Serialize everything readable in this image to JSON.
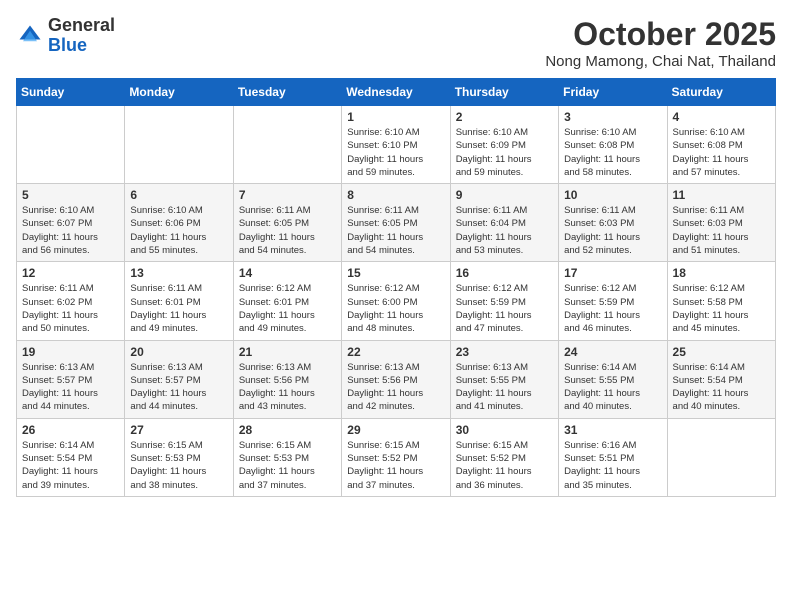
{
  "header": {
    "logo_general": "General",
    "logo_blue": "Blue",
    "month": "October 2025",
    "location": "Nong Mamong, Chai Nat, Thailand"
  },
  "weekdays": [
    "Sunday",
    "Monday",
    "Tuesday",
    "Wednesday",
    "Thursday",
    "Friday",
    "Saturday"
  ],
  "weeks": [
    [
      {
        "day": "",
        "info": ""
      },
      {
        "day": "",
        "info": ""
      },
      {
        "day": "",
        "info": ""
      },
      {
        "day": "1",
        "info": "Sunrise: 6:10 AM\nSunset: 6:10 PM\nDaylight: 11 hours\nand 59 minutes."
      },
      {
        "day": "2",
        "info": "Sunrise: 6:10 AM\nSunset: 6:09 PM\nDaylight: 11 hours\nand 59 minutes."
      },
      {
        "day": "3",
        "info": "Sunrise: 6:10 AM\nSunset: 6:08 PM\nDaylight: 11 hours\nand 58 minutes."
      },
      {
        "day": "4",
        "info": "Sunrise: 6:10 AM\nSunset: 6:08 PM\nDaylight: 11 hours\nand 57 minutes."
      }
    ],
    [
      {
        "day": "5",
        "info": "Sunrise: 6:10 AM\nSunset: 6:07 PM\nDaylight: 11 hours\nand 56 minutes."
      },
      {
        "day": "6",
        "info": "Sunrise: 6:10 AM\nSunset: 6:06 PM\nDaylight: 11 hours\nand 55 minutes."
      },
      {
        "day": "7",
        "info": "Sunrise: 6:11 AM\nSunset: 6:05 PM\nDaylight: 11 hours\nand 54 minutes."
      },
      {
        "day": "8",
        "info": "Sunrise: 6:11 AM\nSunset: 6:05 PM\nDaylight: 11 hours\nand 54 minutes."
      },
      {
        "day": "9",
        "info": "Sunrise: 6:11 AM\nSunset: 6:04 PM\nDaylight: 11 hours\nand 53 minutes."
      },
      {
        "day": "10",
        "info": "Sunrise: 6:11 AM\nSunset: 6:03 PM\nDaylight: 11 hours\nand 52 minutes."
      },
      {
        "day": "11",
        "info": "Sunrise: 6:11 AM\nSunset: 6:03 PM\nDaylight: 11 hours\nand 51 minutes."
      }
    ],
    [
      {
        "day": "12",
        "info": "Sunrise: 6:11 AM\nSunset: 6:02 PM\nDaylight: 11 hours\nand 50 minutes."
      },
      {
        "day": "13",
        "info": "Sunrise: 6:11 AM\nSunset: 6:01 PM\nDaylight: 11 hours\nand 49 minutes."
      },
      {
        "day": "14",
        "info": "Sunrise: 6:12 AM\nSunset: 6:01 PM\nDaylight: 11 hours\nand 49 minutes."
      },
      {
        "day": "15",
        "info": "Sunrise: 6:12 AM\nSunset: 6:00 PM\nDaylight: 11 hours\nand 48 minutes."
      },
      {
        "day": "16",
        "info": "Sunrise: 6:12 AM\nSunset: 5:59 PM\nDaylight: 11 hours\nand 47 minutes."
      },
      {
        "day": "17",
        "info": "Sunrise: 6:12 AM\nSunset: 5:59 PM\nDaylight: 11 hours\nand 46 minutes."
      },
      {
        "day": "18",
        "info": "Sunrise: 6:12 AM\nSunset: 5:58 PM\nDaylight: 11 hours\nand 45 minutes."
      }
    ],
    [
      {
        "day": "19",
        "info": "Sunrise: 6:13 AM\nSunset: 5:57 PM\nDaylight: 11 hours\nand 44 minutes."
      },
      {
        "day": "20",
        "info": "Sunrise: 6:13 AM\nSunset: 5:57 PM\nDaylight: 11 hours\nand 44 minutes."
      },
      {
        "day": "21",
        "info": "Sunrise: 6:13 AM\nSunset: 5:56 PM\nDaylight: 11 hours\nand 43 minutes."
      },
      {
        "day": "22",
        "info": "Sunrise: 6:13 AM\nSunset: 5:56 PM\nDaylight: 11 hours\nand 42 minutes."
      },
      {
        "day": "23",
        "info": "Sunrise: 6:13 AM\nSunset: 5:55 PM\nDaylight: 11 hours\nand 41 minutes."
      },
      {
        "day": "24",
        "info": "Sunrise: 6:14 AM\nSunset: 5:55 PM\nDaylight: 11 hours\nand 40 minutes."
      },
      {
        "day": "25",
        "info": "Sunrise: 6:14 AM\nSunset: 5:54 PM\nDaylight: 11 hours\nand 40 minutes."
      }
    ],
    [
      {
        "day": "26",
        "info": "Sunrise: 6:14 AM\nSunset: 5:54 PM\nDaylight: 11 hours\nand 39 minutes."
      },
      {
        "day": "27",
        "info": "Sunrise: 6:15 AM\nSunset: 5:53 PM\nDaylight: 11 hours\nand 38 minutes."
      },
      {
        "day": "28",
        "info": "Sunrise: 6:15 AM\nSunset: 5:53 PM\nDaylight: 11 hours\nand 37 minutes."
      },
      {
        "day": "29",
        "info": "Sunrise: 6:15 AM\nSunset: 5:52 PM\nDaylight: 11 hours\nand 37 minutes."
      },
      {
        "day": "30",
        "info": "Sunrise: 6:15 AM\nSunset: 5:52 PM\nDaylight: 11 hours\nand 36 minutes."
      },
      {
        "day": "31",
        "info": "Sunrise: 6:16 AM\nSunset: 5:51 PM\nDaylight: 11 hours\nand 35 minutes."
      },
      {
        "day": "",
        "info": ""
      }
    ]
  ]
}
